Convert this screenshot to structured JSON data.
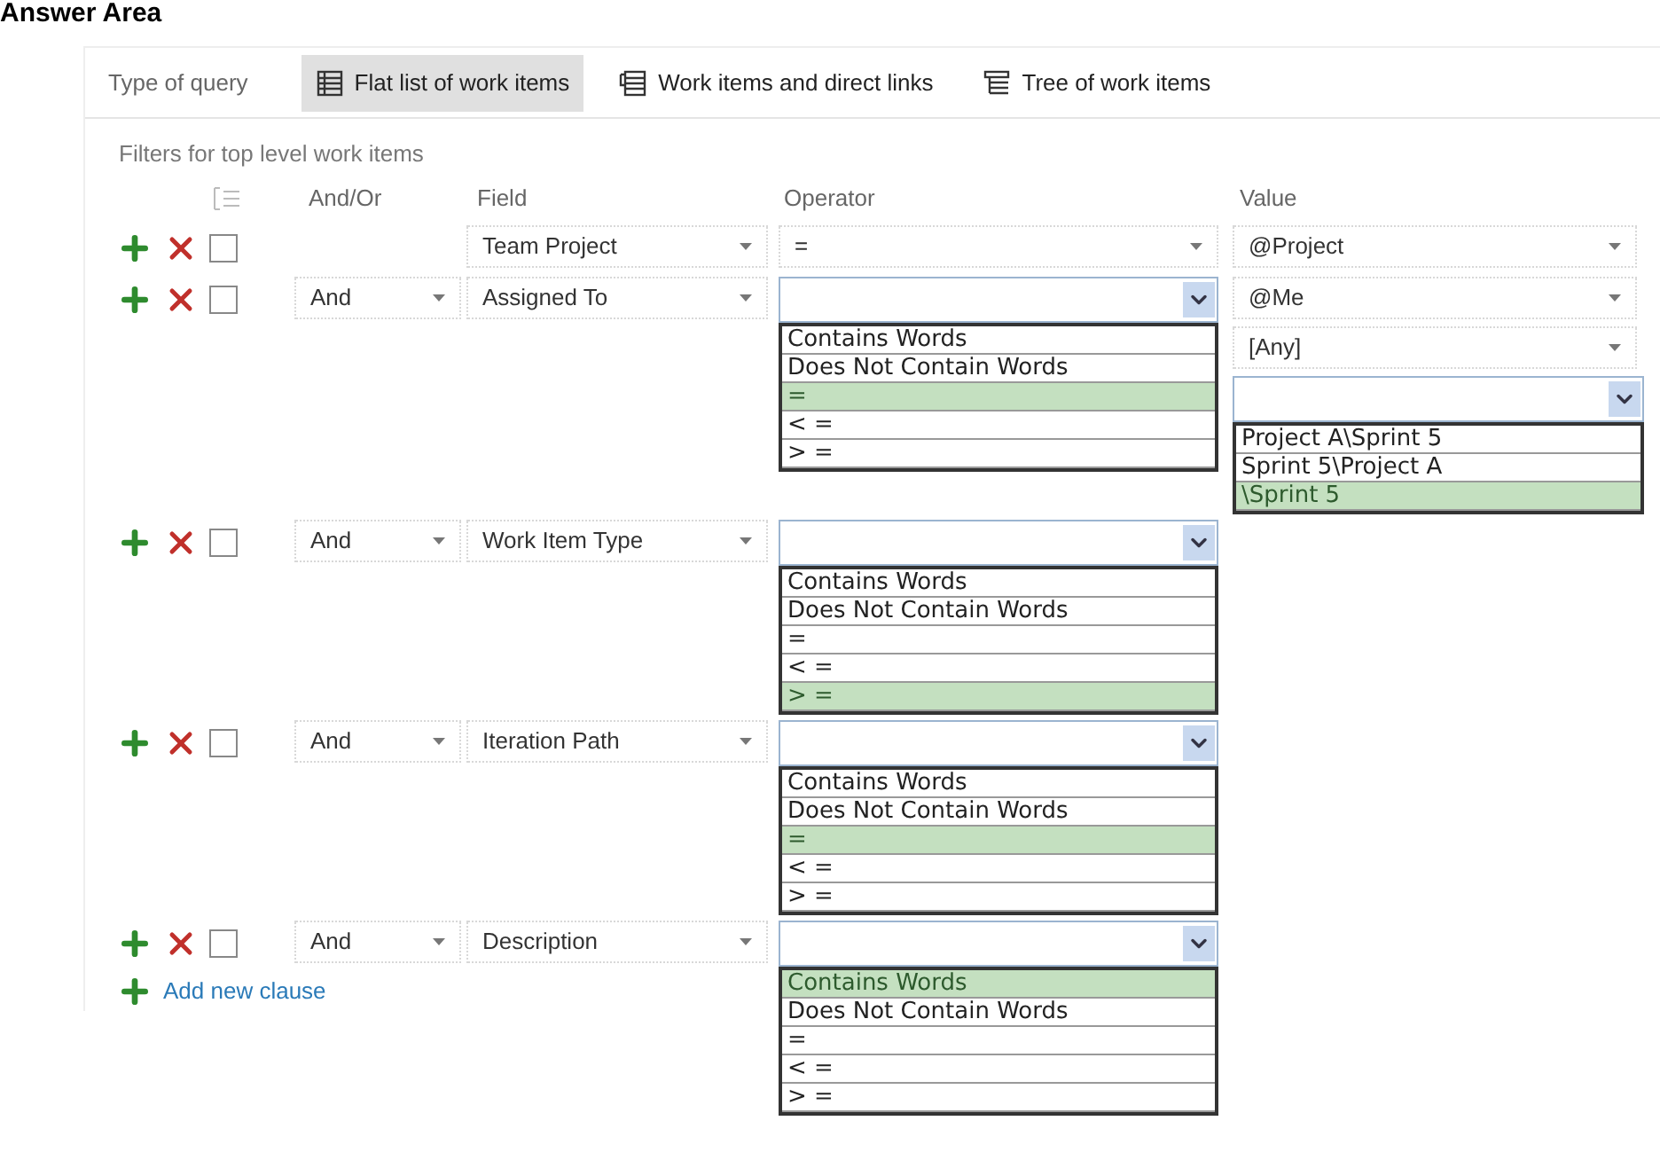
{
  "heading": "Answer Area",
  "query_type": {
    "label": "Type of query",
    "options": [
      {
        "label": "Flat list of work items",
        "selected": true,
        "kind": "flat"
      },
      {
        "label": "Work items and direct links",
        "selected": false,
        "kind": "links"
      },
      {
        "label": "Tree of work items",
        "selected": false,
        "kind": "tree"
      }
    ]
  },
  "filters_title": "Filters for top level work items",
  "columns": [
    "And/Or",
    "Field",
    "Operator",
    "Value"
  ],
  "clauses": [
    {
      "checked": false,
      "field": "Team Project",
      "operator": {
        "value": "="
      },
      "values": [
        {
          "kind": "select",
          "text": "@Project"
        }
      ]
    },
    {
      "checked": false,
      "and_or": "And",
      "field": "Assigned To",
      "operator": {
        "options": [
          {
            "label": "Contains Words",
            "selected": false
          },
          {
            "label": "Does Not Contain Words",
            "selected": false
          },
          {
            "label": "=",
            "selected": true
          },
          {
            "label": "< =",
            "selected": false
          },
          {
            "label": "> =",
            "selected": false
          }
        ]
      },
      "values": [
        {
          "kind": "select",
          "text": "@Me"
        },
        {
          "kind": "select",
          "text": "[Any]"
        },
        {
          "kind": "open",
          "options": [
            {
              "label": "Project A\\Sprint 5",
              "selected": false
            },
            {
              "label": "Sprint 5\\Project A",
              "selected": false
            },
            {
              "label": "\\Sprint 5",
              "selected": true
            }
          ]
        }
      ]
    },
    {
      "checked": false,
      "and_or": "And",
      "field": "Work Item Type",
      "operator": {
        "options": [
          {
            "label": "Contains Words",
            "selected": false
          },
          {
            "label": "Does Not Contain Words",
            "selected": false
          },
          {
            "label": "=",
            "selected": false
          },
          {
            "label": "< =",
            "selected": false
          },
          {
            "label": "> =",
            "selected": true
          }
        ]
      }
    },
    {
      "checked": false,
      "and_or": "And",
      "field": "Iteration Path",
      "operator": {
        "options": [
          {
            "label": "Contains Words",
            "selected": false
          },
          {
            "label": "Does Not Contain Words",
            "selected": false
          },
          {
            "label": "=",
            "selected": true
          },
          {
            "label": "< =",
            "selected": false
          },
          {
            "label": "> =",
            "selected": false
          }
        ]
      }
    },
    {
      "checked": false,
      "and_or": "And",
      "field": "Description",
      "operator": {
        "options": [
          {
            "label": "Contains Words",
            "selected": true
          },
          {
            "label": "Does Not Contain Words",
            "selected": false
          },
          {
            "label": "=",
            "selected": false
          },
          {
            "label": "< =",
            "selected": false
          },
          {
            "label": "> =",
            "selected": false
          }
        ]
      }
    }
  ],
  "add_clause": "Add new clause"
}
